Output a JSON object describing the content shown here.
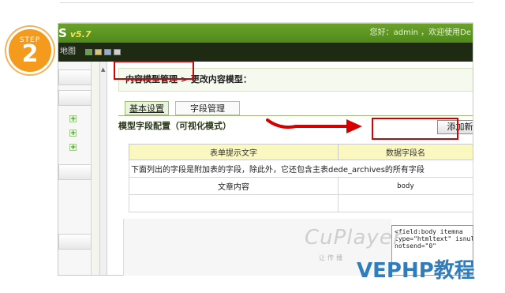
{
  "step": {
    "label": "STEP",
    "number": "2"
  },
  "app": {
    "logo": "S",
    "version": "v5.7",
    "greeting": "您好：admin ，欢迎使用De",
    "map_label": "地图"
  },
  "breadcrumb": "内容模型管理 > 更改内容模型：",
  "tabs": [
    {
      "label": "基本设置"
    },
    {
      "label": "字段管理"
    }
  ],
  "section_title": "模型字段配置（可视化模式）",
  "add_field_button": "添加新字段",
  "table": {
    "headers": [
      "表单提示文字",
      "数据字段名"
    ],
    "note": "下面列出的字段是附加表的字段，除此外，它还包含主表dede_archives的所有字段",
    "rows": [
      {
        "label": "文章内容",
        "field": "body"
      },
      {
        "label": "",
        "field": ""
      }
    ]
  },
  "code_snippet": [
    "<field:body itemna",
    "type=\"htmltext\" isnull",
    "notsend=\"0\""
  ],
  "overlay_logo": {
    "text": "CuPlayer",
    "subtext": "让传播"
  },
  "watermark": "VEPHP教程",
  "colors": {
    "accent_green": "#5b9624",
    "highlight_red": "#d60000",
    "step_orange": "#f49a1c",
    "watermark_blue": "#2f7dbd",
    "table_header_yellow": "#fbf7c0"
  },
  "icons": [
    "plus-icon",
    "arrow-right-icon"
  ]
}
